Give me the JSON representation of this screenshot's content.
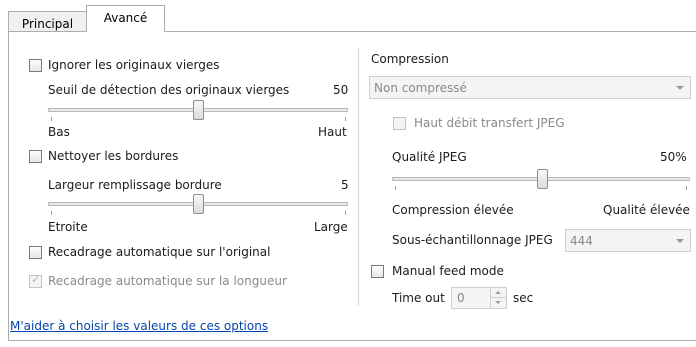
{
  "tabs": [
    "Principal",
    "Avancé"
  ],
  "left": {
    "ignore_blank": {
      "label": "Ignorer les originaux vierges",
      "checked": false
    },
    "blank_threshold": {
      "label": "Seuil de détection des originaux vierges",
      "value": "50",
      "min_label": "Bas",
      "max_label": "Haut",
      "fraction": 0.5
    },
    "clean_borders": {
      "label": "Nettoyer les bordures",
      "checked": false
    },
    "border_fill": {
      "label": "Largeur remplissage bordure",
      "value": "5",
      "min_label": "Etroite",
      "max_label": "Large",
      "fraction": 0.5
    },
    "auto_crop_original": {
      "label": "Recadrage automatique sur l'original",
      "checked": false
    },
    "auto_crop_length": {
      "label": "Recadrage automatique sur la longueur",
      "checked": true,
      "disabled": true
    }
  },
  "right": {
    "compression_label": "Compression",
    "compression_value": "Non compressé",
    "jpeg_high_throughput": {
      "label": "Haut débit transfert JPEG",
      "checked": false,
      "disabled": true
    },
    "jpeg_quality": {
      "label": "Qualité JPEG",
      "value": "50%",
      "min_label": "Compression élevée",
      "max_label": "Qualité élevée",
      "fraction": 0.5
    },
    "subsampling": {
      "label": "Sous-échantillonnage JPEG",
      "value": "444"
    },
    "manual_feed": {
      "label": "Manual feed mode",
      "checked": false
    },
    "timeout": {
      "label": "Time out",
      "value": "0",
      "unit": "sec"
    }
  },
  "help_link": "M'aider à choisir les valeurs de ces options",
  "colors": {
    "link": "#0645ad",
    "disabled_text": "#8a8a8a"
  }
}
